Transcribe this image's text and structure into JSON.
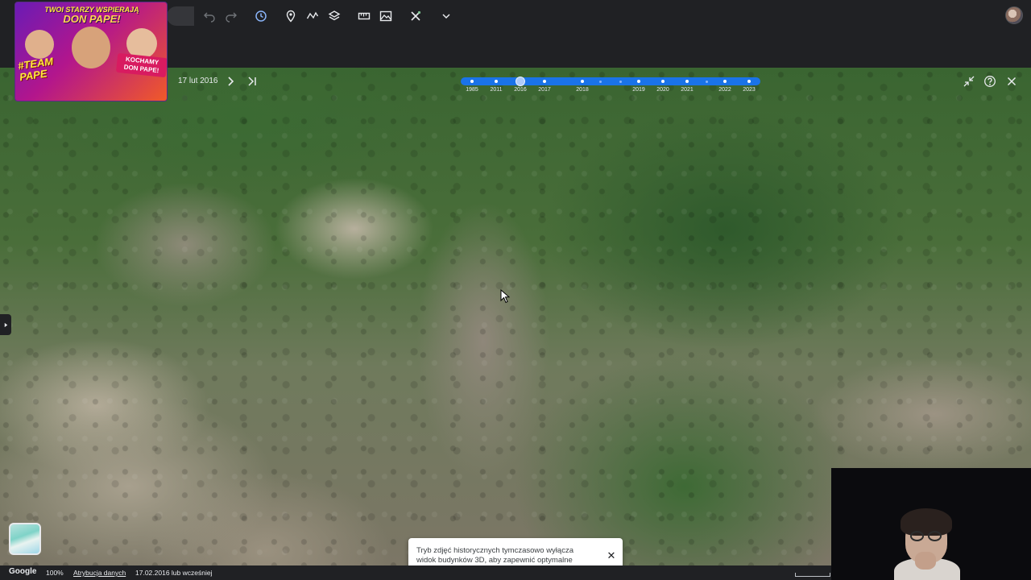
{
  "toolbar": {
    "tools": [
      {
        "name": "undo",
        "icon": "undo-icon",
        "enabled": false
      },
      {
        "name": "redo",
        "icon": "redo-icon",
        "enabled": false
      },
      {
        "name": "historical-imagery",
        "icon": "history-icon",
        "enabled": true
      },
      {
        "name": "add-placemark",
        "icon": "placemark-icon",
        "enabled": true
      },
      {
        "name": "add-path",
        "icon": "path-icon",
        "enabled": true
      },
      {
        "name": "map-style",
        "icon": "layers-icon",
        "enabled": true
      },
      {
        "name": "measure",
        "icon": "ruler-icon",
        "enabled": true
      },
      {
        "name": "capture-image",
        "icon": "image-icon",
        "enabled": true
      },
      {
        "name": "tools",
        "icon": "tools-icon",
        "enabled": true
      },
      {
        "name": "more",
        "icon": "chevron-down-icon",
        "enabled": true
      }
    ]
  },
  "timeline": {
    "current_date": "17 lut 2016",
    "years": [
      "1985",
      "2011",
      "2016",
      "2017",
      "2018",
      "2019",
      "2020",
      "2021",
      "2022",
      "2023"
    ],
    "selected_year": "2016",
    "track_color": "#1a73e8"
  },
  "ad_banner": {
    "headline_top": "TWOI STARZY WSPIERAJĄ",
    "headline_main": "DON PAPE!",
    "tag_left": "#TEAM PAPE",
    "tag_right": "KOCHAMY DON PAPE!"
  },
  "toast": {
    "message": "Tryb zdjęć historycznych tymczasowo wyłącza widok budynków 3D, aby zapewnić optymalne wyświetlanie.",
    "close_symbol": "✕"
  },
  "statusbar": {
    "brand": "Google",
    "zoom": "100%",
    "attribution_link": "Atrybucja danych",
    "imagery_date": "17.02.2016 lub wcześniej"
  },
  "right_controls": {
    "collapse_icon": "collapse-icon",
    "help_icon": "help-icon",
    "close_icon": "close-icon"
  }
}
